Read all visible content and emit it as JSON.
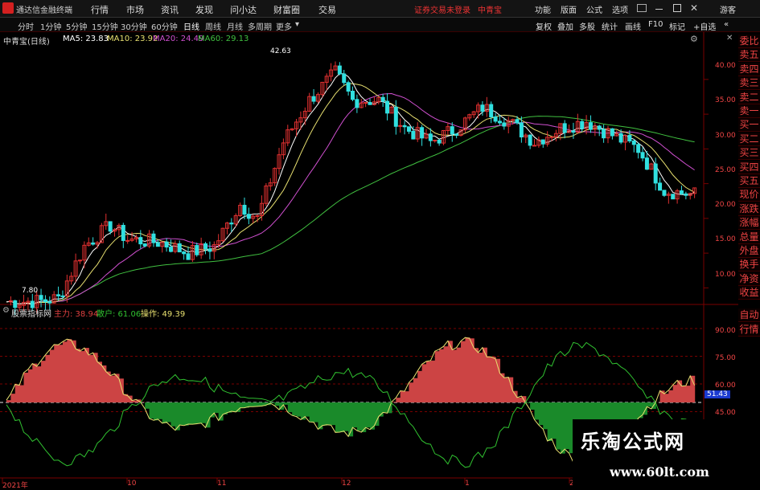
{
  "app": {
    "title": "通达信金融终端",
    "status": "证券交易未登录",
    "user_stock": "中青宝",
    "guest": "游客"
  },
  "menu": [
    "行情",
    "市场",
    "资讯",
    "发现",
    "问小达",
    "财富圈",
    "交易"
  ],
  "menu_right": [
    "功能",
    "版面",
    "公式",
    "选项"
  ],
  "timeframes": [
    "分时",
    "1分钟",
    "5分钟",
    "15分钟",
    "30分钟",
    "60分钟",
    "日线",
    "周线",
    "月线",
    "多周期",
    "更多"
  ],
  "timeframe_active": "日线",
  "toolbar_right": [
    "复权",
    "叠加",
    "多股",
    "统计",
    "画线",
    "F10",
    "标记",
    "+自选"
  ],
  "chart": {
    "name": "中青宝(日线)",
    "ma": [
      {
        "label": "MA5: 23.83",
        "color": "#ffffff"
      },
      {
        "label": "MA10: 23.92",
        "color": "#e8e070"
      },
      {
        "label": "MA20: 24.49",
        "color": "#d050d0"
      },
      {
        "label": "MA60: 29.13",
        "color": "#40c040"
      }
    ],
    "high_label": "42.63",
    "low_label": "7.80",
    "price_ticks": [
      "40.00",
      "35.00",
      "30.00",
      "25.00",
      "20.00",
      "15.00",
      "10.00"
    ]
  },
  "indicator": {
    "name": "股票指标网",
    "items": [
      {
        "label": "主力: 38.94",
        "color": "#e04040"
      },
      {
        "label": "散户: 61.06",
        "color": "#30c030"
      },
      {
        "label": "操作: 49.39",
        "color": "#e8e070"
      }
    ],
    "ticks": [
      "90.00",
      "75.00",
      "60.00",
      "45.00"
    ],
    "current": "51.43"
  },
  "date_labels": [
    "2021年",
    "10",
    "11",
    "12",
    "1",
    "2"
  ],
  "side_tabs": [
    "委比",
    "卖五",
    "卖四",
    "卖三",
    "卖二",
    "卖一",
    "买一",
    "买二",
    "买三",
    "买四",
    "买五",
    "现价",
    "涨跌",
    "涨幅",
    "总量",
    "外盘",
    "换手",
    "净资",
    "收益"
  ],
  "side_tabs_lower": [
    "自动",
    "行情"
  ],
  "watermark": {
    "title": "乐淘公式网",
    "url": "www.60lt.com"
  },
  "colors": {
    "up": "#e03030",
    "down": "#30e0e0",
    "bg": "#000000",
    "grid": "#7a0000"
  }
}
